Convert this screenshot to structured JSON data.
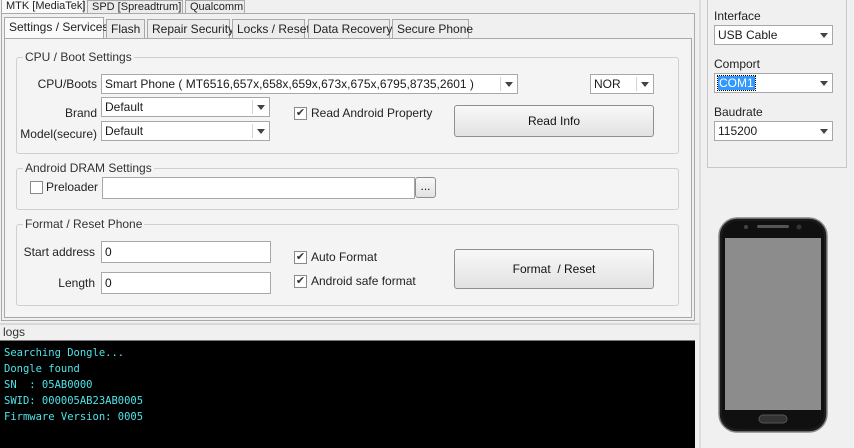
{
  "top_tabs": [
    "MTK [MediaTek]",
    "SPD [Spreadtrum]",
    "Qualcomm"
  ],
  "sub_tabs": [
    "Settings / Services",
    "Flash",
    "Repair Security",
    "Locks / Reset",
    "Data Recovery",
    "Secure Phone"
  ],
  "cpu_boot": {
    "title": "CPU / Boot Settings",
    "cpu_label": "CPU/Boots",
    "cpu_value": "Smart Phone ( MT6516,657x,658x,659x,673x,675x,6795,8735,2601 )",
    "storage_value": "NOR",
    "brand_label": "Brand",
    "brand_value": "Default",
    "model_label": "Model(secure)",
    "model_value": "Default",
    "read_android_label": "Read Android Property",
    "read_info_label": "Read Info",
    "read_android_checked": true
  },
  "dram": {
    "title": "Android DRAM Settings",
    "preloader_label": "Preloader",
    "preloader_value": "",
    "browse_label": "...",
    "preloader_checked": false
  },
  "format": {
    "title": "Format / Reset Phone",
    "start_label": "Start address",
    "start_value": "0",
    "length_label": "Length",
    "length_value": "0",
    "auto_format_label": "Auto Format",
    "auto_format_checked": true,
    "safe_format_label": "Android safe format",
    "safe_format_checked": true,
    "format_button_label": "Format  / Reset"
  },
  "connection": {
    "interface_label": "Interface",
    "interface_value": "USB Cable",
    "comport_label": "Comport",
    "comport_value": "COM1",
    "baudrate_label": "Baudrate",
    "baudrate_value": "115200"
  },
  "logs": {
    "label": "logs",
    "lines": [
      "Searching Dongle...",
      "Dongle found",
      "SN  : 05AB0000",
      "SWID: 000005AB23AB0005",
      "Firmware Version: 0005"
    ],
    "text_color": "#4fe3e8"
  },
  "phone_icon": "smartphone-icon"
}
